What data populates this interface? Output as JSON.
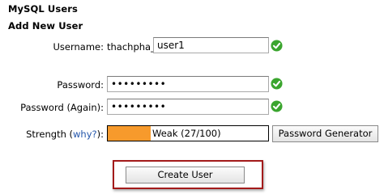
{
  "section_title": "MySQL Users",
  "subsection_title": "Add New User",
  "username": {
    "label": "Username:",
    "prefix": "thachpha_",
    "value": "user1",
    "valid_icon": "green-check-icon"
  },
  "password": {
    "label": "Password:",
    "value": "•••••••••",
    "valid_icon": "green-check-icon"
  },
  "password_again": {
    "label": "Password (Again):",
    "value": "•••••••••",
    "valid_icon": "green-check-icon"
  },
  "strength": {
    "label_prefix": "Strength (",
    "link_text": "why?",
    "label_suffix": "):",
    "text": "Weak (27/100)",
    "score": 27,
    "max": 100,
    "fill_color": "#f79a2c"
  },
  "password_generator_label": "Password Generator",
  "create_user_label": "Create User",
  "colors": {
    "check": "#3aa52e",
    "link": "#2255aa",
    "highlight": "#a31a1a"
  }
}
